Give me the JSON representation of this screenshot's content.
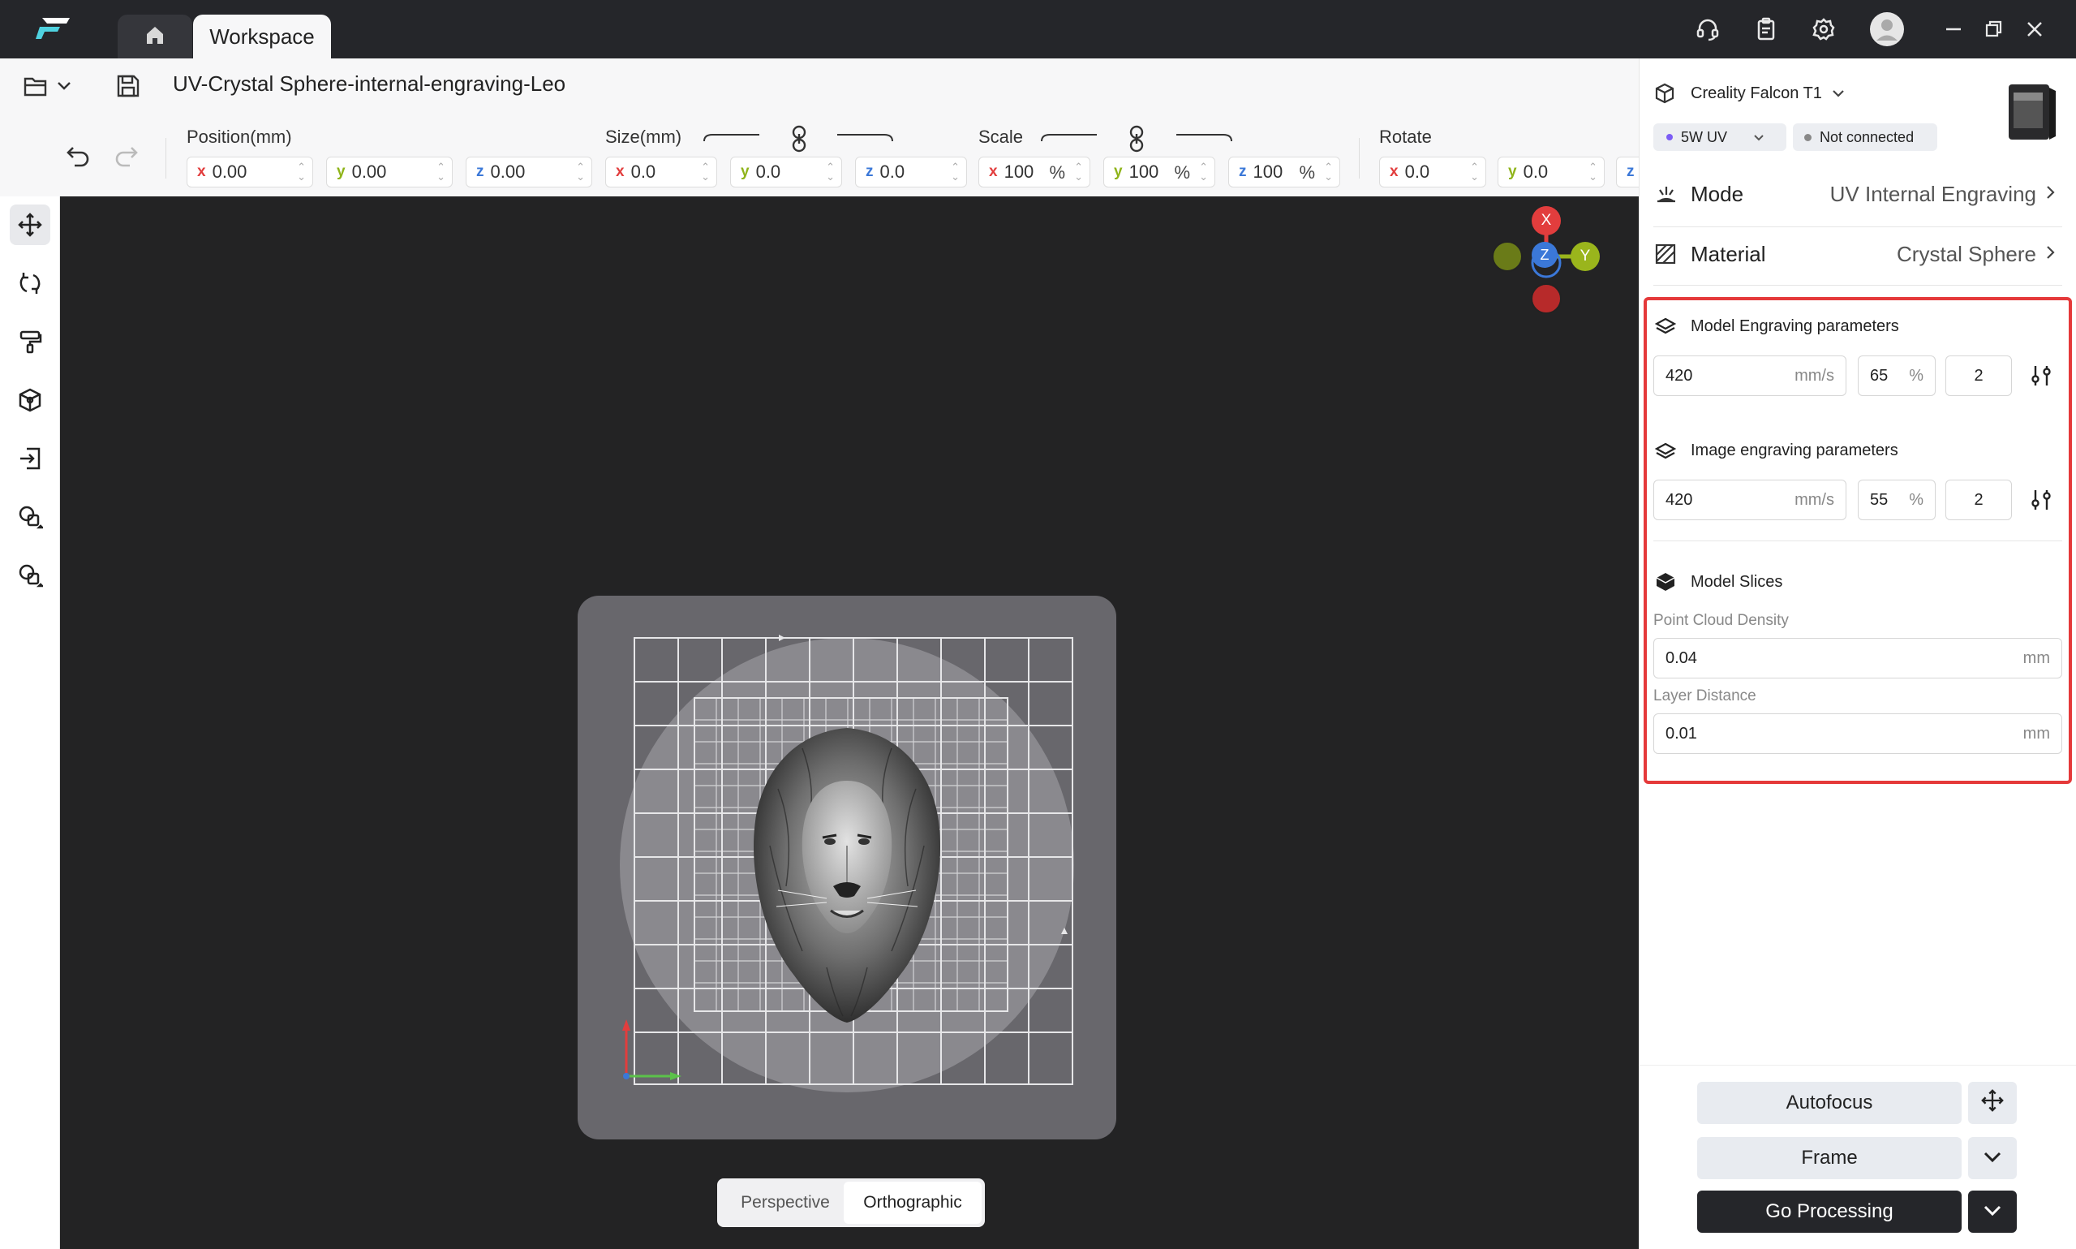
{
  "app": {
    "tabs": [
      {
        "label": "Workspace"
      }
    ],
    "filename": "UV-Crystal Sphere-internal-engraving-Leo"
  },
  "icons": {
    "logo": "creality-logo-icon",
    "home": "home-icon",
    "support": "headset-icon",
    "clipboard": "clipboard-icon",
    "settings": "gear-icon",
    "avatar": "avatar-icon",
    "minimize": "minimize-icon",
    "restore": "restore-icon",
    "close": "close-icon"
  },
  "transform": {
    "position": {
      "label": "Position(mm)",
      "x_axis": "x",
      "x": "0.00",
      "y_axis": "y",
      "y": "0.00",
      "z_axis": "z",
      "z": "0.00"
    },
    "size": {
      "label": "Size(mm)",
      "x_axis": "x",
      "x": "0.0",
      "y_axis": "y",
      "y": "0.0",
      "z_axis": "z",
      "z": "0.0"
    },
    "scale": {
      "label": "Scale",
      "x_axis": "x",
      "x": "100",
      "y_axis": "y",
      "y": "100",
      "z_axis": "z",
      "z": "100",
      "unit": "%"
    },
    "rotate": {
      "label": "Rotate",
      "x_axis": "x",
      "x": "0.0",
      "y_axis": "y",
      "y": "0.0",
      "z_axis": "z"
    }
  },
  "viewport": {
    "view_modes": [
      "Perspective",
      "Orthographic"
    ],
    "active_view": "Orthographic",
    "gizmo": {
      "x": "X",
      "y": "Y",
      "z": "Z"
    }
  },
  "device": {
    "name": "Creality Falcon T1",
    "laser": "5W UV",
    "status": "Not connected"
  },
  "settings": {
    "mode": {
      "label": "Mode",
      "value": "UV Internal Engraving"
    },
    "material": {
      "label": "Material",
      "value": "Crystal Sphere"
    }
  },
  "params": {
    "model_engraving": {
      "title": "Model Engraving parameters",
      "speed": "420",
      "speed_unit": "mm/s",
      "power": "65",
      "power_unit": "%",
      "passes": "2"
    },
    "image_engraving": {
      "title": "Image engraving parameters",
      "speed": "420",
      "speed_unit": "mm/s",
      "power": "55",
      "power_unit": "%",
      "passes": "2"
    },
    "model_slices": {
      "title": "Model Slices",
      "density_label": "Point Cloud Density",
      "density": "0.04",
      "density_unit": "mm",
      "layer_label": "Layer Distance",
      "layer": "0.01",
      "layer_unit": "mm"
    }
  },
  "actions": {
    "autofocus": "Autofocus",
    "frame": "Frame",
    "go": "Go Processing"
  },
  "colors": {
    "accent_red": "#e23d3d",
    "dark": "#25262a",
    "highlight": "#e5393a"
  }
}
